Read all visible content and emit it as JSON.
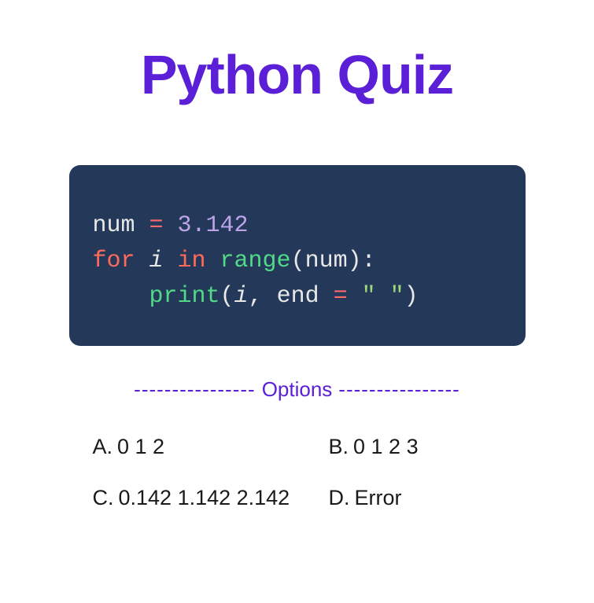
{
  "title": "Python Quiz",
  "code": {
    "line1": {
      "t1": "num ",
      "t2": "=",
      "t3": " 3.142"
    },
    "line2": {
      "t1": "for",
      "t2": " i ",
      "t3": "in",
      "t4": " range",
      "t5": "(",
      "t6": "num",
      "t7": "):"
    },
    "line3": {
      "t1": "    print",
      "t2": "(",
      "t3": "i",
      "t4": ", end ",
      "t5": "=",
      "t6": " \" \"",
      "t7": ")"
    }
  },
  "options_heading": {
    "left_dashes": "----------------",
    "label": "Options",
    "right_dashes": "----------------"
  },
  "options": {
    "a": {
      "letter": "A.",
      "text": "0 1 2"
    },
    "b": {
      "letter": "B.",
      "text": "0 1 2 3"
    },
    "c": {
      "letter": "C.",
      "text": "0.142 1.142 2.142"
    },
    "d": {
      "letter": "D.",
      "text": "Error"
    }
  }
}
